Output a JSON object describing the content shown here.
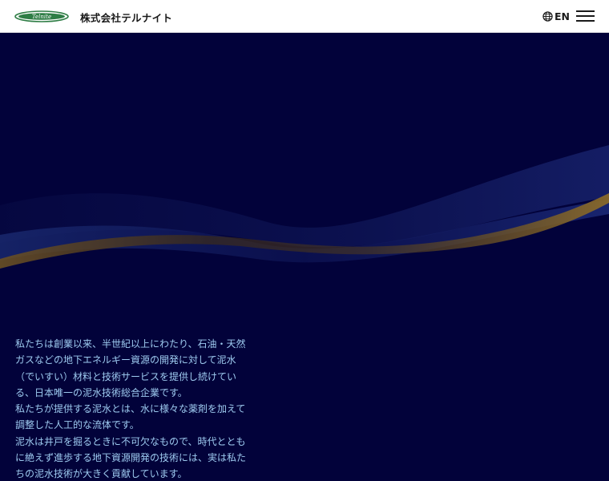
{
  "header": {
    "logo_text": "Telnite",
    "company_name": "株式会社テルナイト",
    "lang_icon": "globe-icon",
    "lang_label": "EN",
    "menu_icon": "hamburger-menu-icon"
  },
  "hero": {
    "paragraphs": [
      "私たちは創業以来、半世紀以上にわたり、石油・天然ガスなどの地下エネルギー資源の開発に対して泥水（でいすい）材料と技術サービスを提供し続けている、日本唯一の泥水技術総合企業です。",
      "私たちが提供する泥水とは、水に様々な薬剤を加えて調整した人工的な流体です。",
      "泥水は井戸を掘るときに不可欠なもので、時代とともに絶えず進歩する地下資源開発の技術には、実は私たちの泥水技術が大きく貢献しています。"
    ]
  },
  "colors": {
    "background": "#02023a",
    "text": "#9ecbf0",
    "accent_gold": "#8a6a2a",
    "logo_green": "#2e7d45"
  }
}
